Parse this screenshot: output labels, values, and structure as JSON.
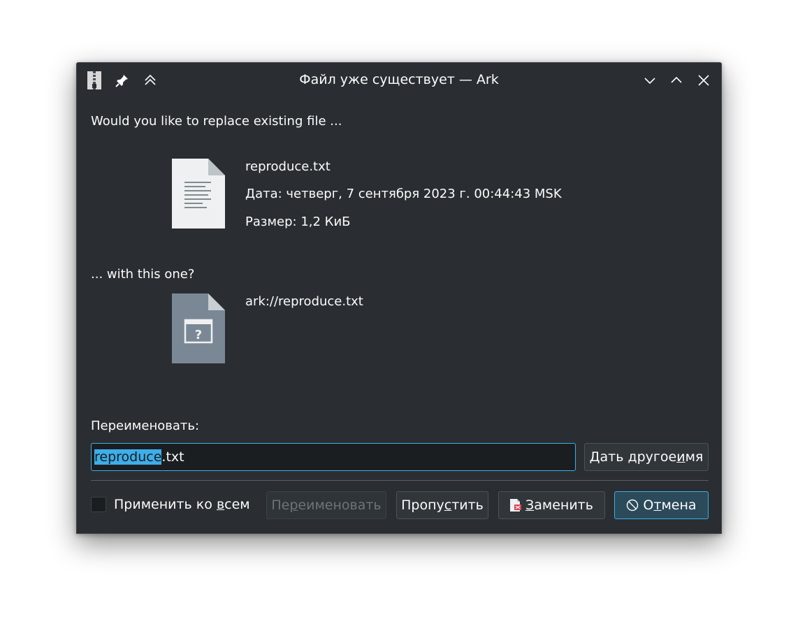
{
  "window": {
    "title": "Файл уже существует — Ark"
  },
  "message": {
    "replace_question": "Would you like to replace existing file ...",
    "with_question": "... with this one?"
  },
  "existing_file": {
    "name": "reproduce.txt",
    "date": "Дата: четверг, 7 сентября 2023 г. 00:44:43 MSK",
    "size": "Размер: 1,2 КиБ",
    "icon": "text-file-icon"
  },
  "new_file": {
    "name": "ark://reproduce.txt",
    "icon": "unknown-file-icon"
  },
  "rename": {
    "label": "Переименовать:",
    "value_selected": "reproduce",
    "value_rest": ".txt",
    "suggest_button": {
      "pre": "Дать другое ",
      "u": "и",
      "post": "мя"
    }
  },
  "footer": {
    "apply_all": {
      "pre": "Применить ко ",
      "u": "в",
      "post": "сем",
      "checked": false
    },
    "rename_button": {
      "pre": "Пе",
      "u": "р",
      "post": "еименовать",
      "disabled": true
    },
    "skip_button": {
      "pre": "Пропу",
      "u": "с",
      "post": "тить"
    },
    "replace_button": {
      "pre": "",
      "u": "З",
      "post": "аменить"
    },
    "cancel_button": {
      "pre": "О",
      "u": "т",
      "post": "мена"
    }
  },
  "colors": {
    "background": "#2a2e32",
    "accent": "#3daee9",
    "text": "#fcfcfc"
  }
}
